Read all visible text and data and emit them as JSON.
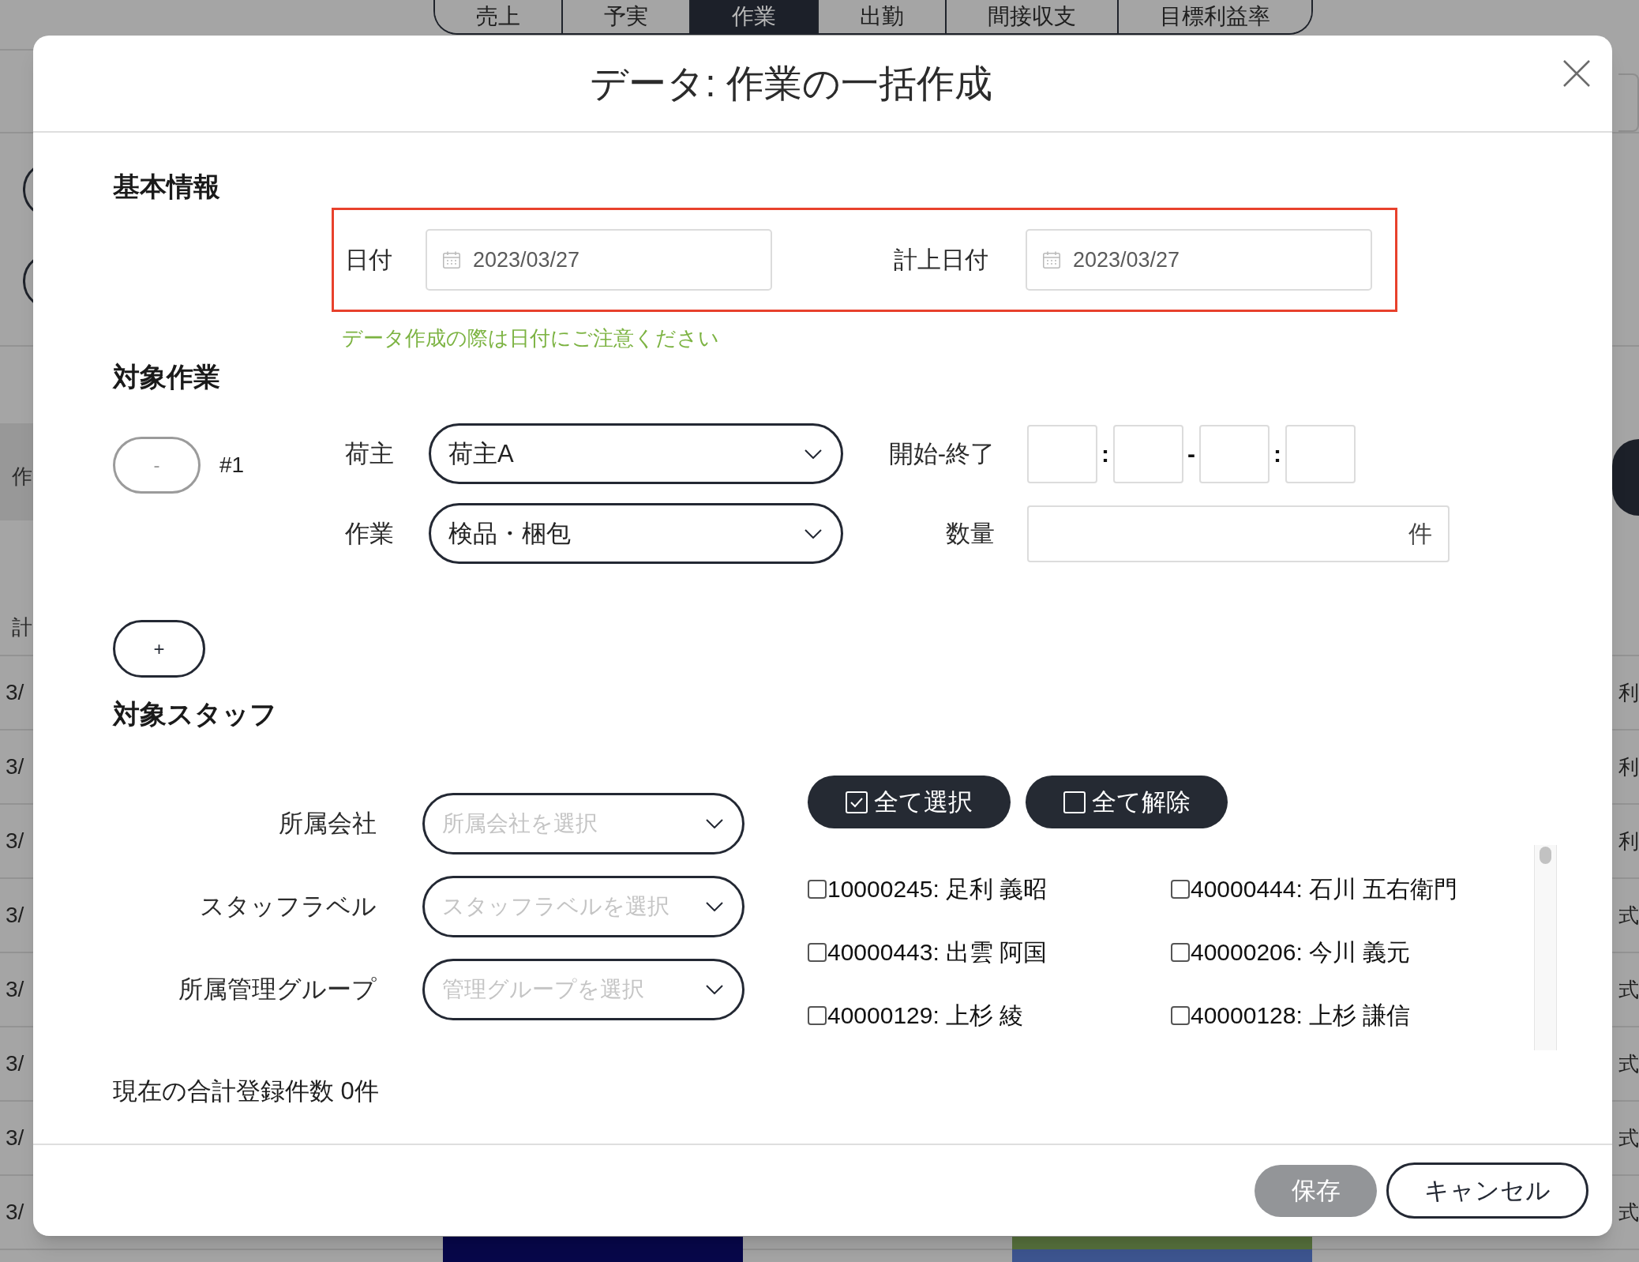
{
  "background_page": {
    "tabs": [
      {
        "label": "売上",
        "selected": false
      },
      {
        "label": "予実",
        "selected": false
      },
      {
        "label": "作業",
        "selected": true
      },
      {
        "label": "出勤",
        "selected": false
      },
      {
        "label": "間接収支",
        "selected": false
      },
      {
        "label": "目標利益率",
        "selected": false
      }
    ],
    "band_label": "作",
    "header_label": "計",
    "rows": [
      {
        "left": "3/",
        "right": "利"
      },
      {
        "left": "3/",
        "right": "利"
      },
      {
        "left": "3/",
        "right": "利"
      },
      {
        "left": "3/",
        "right": "式"
      },
      {
        "left": "3/",
        "right": "式"
      },
      {
        "left": "3/",
        "right": "式"
      },
      {
        "left": "3/",
        "right": "式"
      },
      {
        "left": "3/",
        "right": "式"
      }
    ]
  },
  "dialog": {
    "title": "データ: 作業の一括作成"
  },
  "basic_info": {
    "heading": "基本情報",
    "highlighted": true,
    "dates": [
      {
        "label": "日付",
        "value": "2023/03/27"
      },
      {
        "label": "計上日付",
        "value": "2023/03/27"
      }
    ],
    "hint": "データ作成の際は日付にご注意ください"
  },
  "tasks": {
    "heading": "対象作業",
    "items": [
      {
        "remove_button": {
          "label": "-",
          "disabled": true
        },
        "number": "#1",
        "shipper": {
          "label": "荷主",
          "value": "荷主A"
        },
        "work": {
          "label": "作業",
          "value": "検品・梱包"
        },
        "time": {
          "label": "開始-終了",
          "separators": [
            ":",
            "-",
            ":"
          ]
        },
        "quantity": {
          "label": "数量",
          "unit": "件"
        }
      }
    ],
    "add_button": {
      "label": "+"
    }
  },
  "staff": {
    "heading": "対象スタッフ",
    "filters": [
      {
        "label": "所属会社",
        "placeholder": "所属会社を選択"
      },
      {
        "label": "スタッフラベル",
        "placeholder": "スタッフラベルを選択"
      },
      {
        "label": "所属管理グループ",
        "placeholder": "管理グループを選択"
      }
    ],
    "bulk_buttons": [
      {
        "label": "全て選択",
        "kind": "select"
      },
      {
        "label": "全て解除",
        "kind": "clear"
      }
    ],
    "members": [
      {
        "label": "10000245: 足利 義昭",
        "checked": false
      },
      {
        "label": "40000444: 石川 五右衛門",
        "checked": false
      },
      {
        "label": "40000443: 出雲 阿国",
        "checked": false
      },
      {
        "label": "40000206: 今川 義元",
        "checked": false
      },
      {
        "label": "40000129: 上杉 綾",
        "checked": false
      },
      {
        "label": "40000128: 上杉 謙信",
        "checked": false
      }
    ]
  },
  "total": "現在の合計登録件数 0件",
  "footer": {
    "buttons": [
      {
        "label": "保存",
        "kind": "filled",
        "disabled": true
      },
      {
        "label": "キャンセル",
        "kind": "outlined",
        "disabled": false
      }
    ]
  }
}
